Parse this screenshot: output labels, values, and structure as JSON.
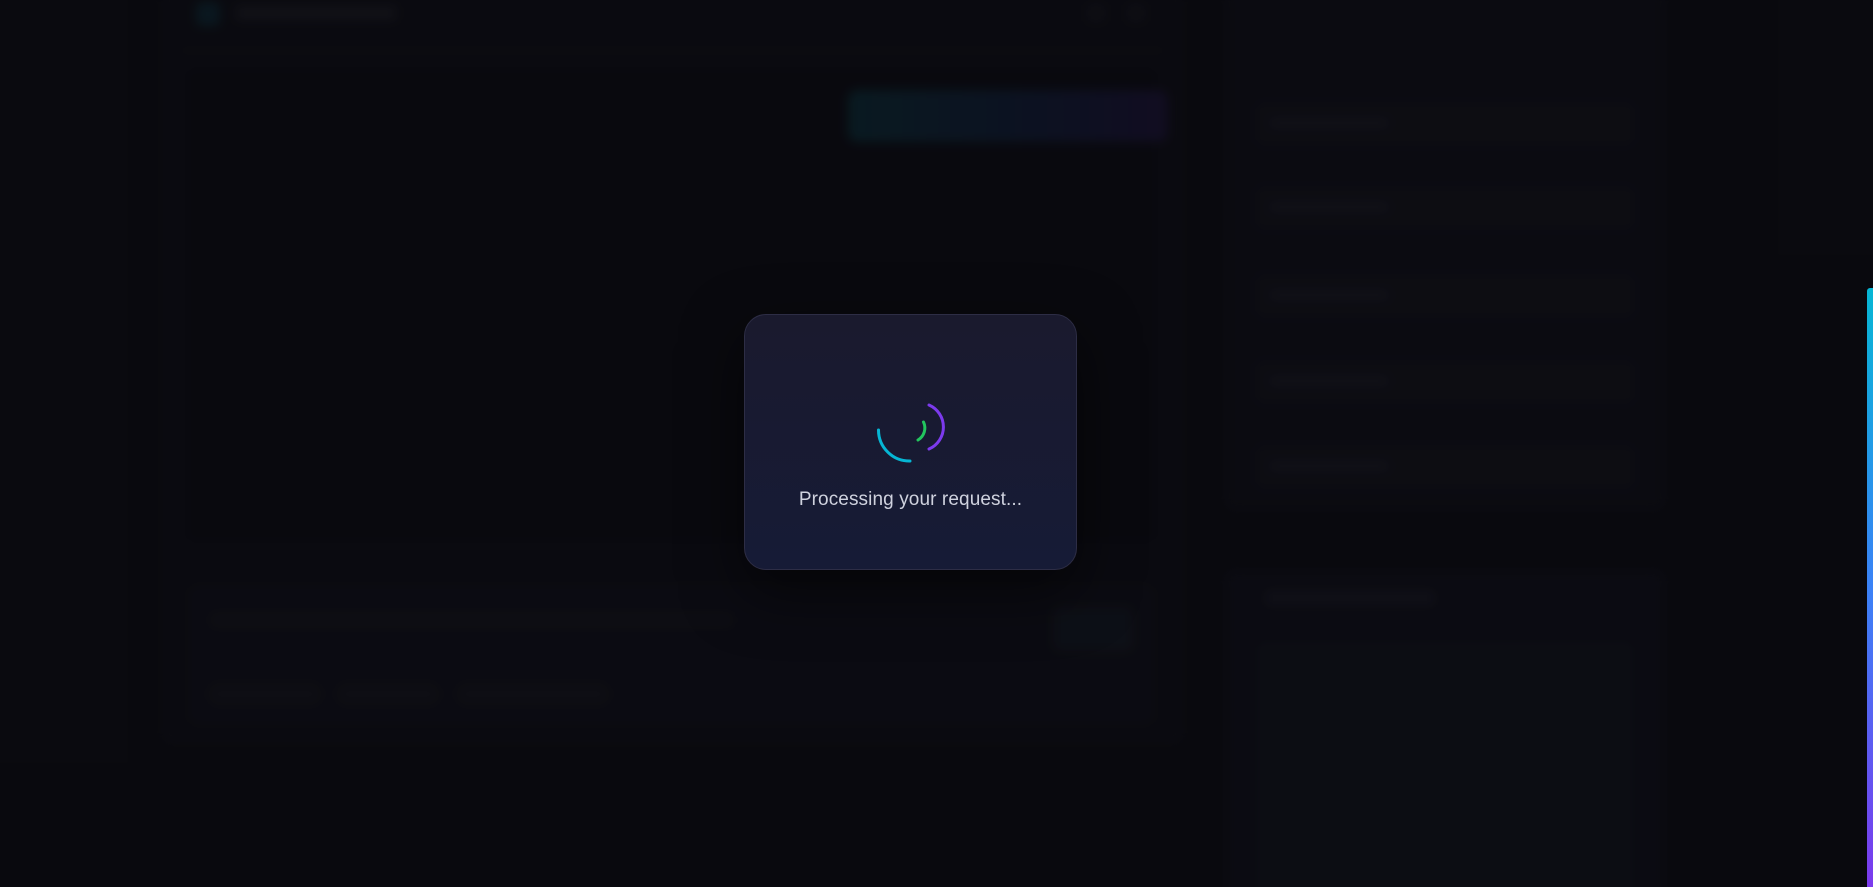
{
  "loading_modal": {
    "message": "Processing your request...",
    "spinner_icon": "loading-spinner-icon"
  },
  "colors": {
    "background": "#0c0c12",
    "modal_bg_top": "#1a1a2e",
    "modal_bg_bottom": "#161b36",
    "modal_border": "#2d2d45",
    "spinner_outer": "#06b6d4",
    "spinner_middle": "#22c55e",
    "spinner_inner": "#7c3aed",
    "accent_gradient_start": "#06b6d4",
    "accent_gradient_end": "#7c3aed",
    "text": "#cfd2de"
  }
}
